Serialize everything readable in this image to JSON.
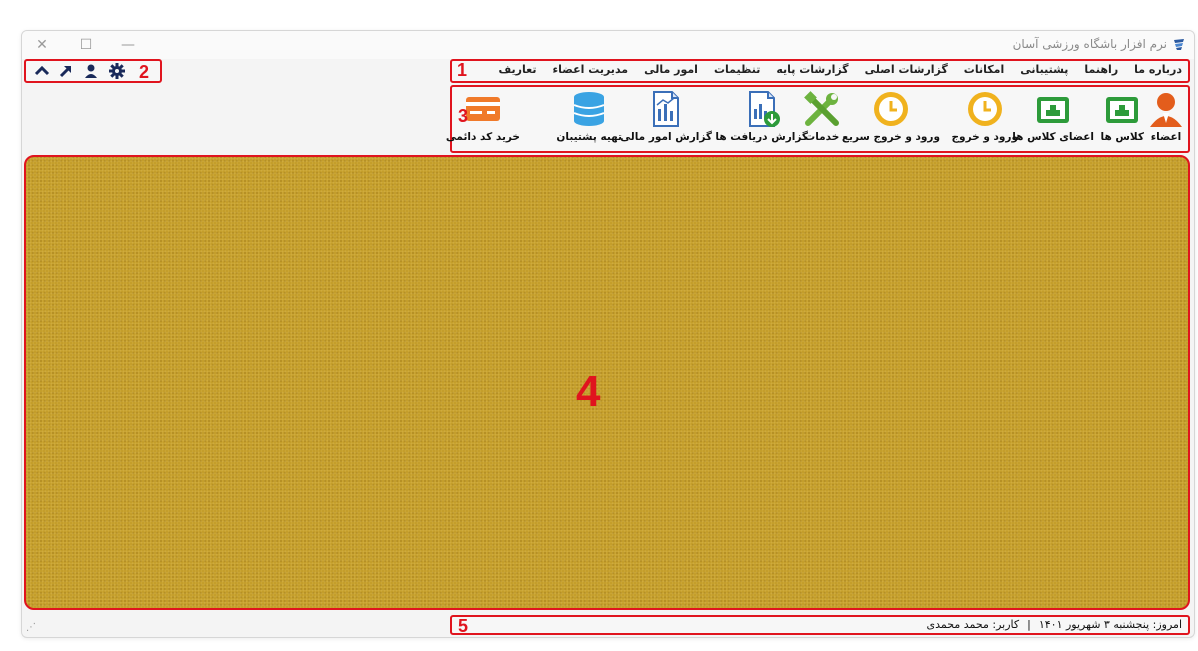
{
  "window": {
    "title": "نرم افزار باشگاه ورزشی آسان",
    "controls": {
      "close": "✕",
      "maximize": "☐",
      "minimize": "—"
    }
  },
  "menu": {
    "items": [
      "تعاریف",
      "مدیریت اعضاء",
      "امور مالی",
      "تنظیمات",
      "گزارشات پایه",
      "گزارشات اصلی",
      "امکانات",
      "پشتیبانی",
      "راهنما",
      "درباره ما"
    ]
  },
  "quickbar": {
    "icons": [
      "collapse-icon",
      "external-link-icon",
      "user-icon",
      "settings-icon"
    ]
  },
  "toolbar": {
    "items": [
      {
        "label": "اعضاء",
        "icon": "member-icon"
      },
      {
        "label": "کلاس ها",
        "icon": "class-icon"
      },
      {
        "label": "اعضای کلاس ها",
        "icon": "class-members-icon"
      },
      {
        "label": "ورود و خروج",
        "icon": "clock-icon"
      },
      {
        "label": "ورود و خروج سریع",
        "icon": "quick-clock-icon"
      },
      {
        "label": "خدمات",
        "icon": "tools-icon"
      },
      {
        "label": "گزارش دریافت ها",
        "icon": "receipts-report-icon"
      },
      {
        "label": "گزارش امور مالی",
        "icon": "finance-report-icon"
      },
      {
        "label": "تهیه پشتیبان",
        "icon": "database-icon"
      },
      {
        "label": "خرید کد دائمی",
        "icon": "credit-card-icon"
      }
    ]
  },
  "status": {
    "today": "امروز: پنجشنبه ۳ شهریور ۱۴۰۱",
    "separator": "|",
    "user": "کاربر: محمد محمدی"
  },
  "regions": {
    "menu": "1",
    "quickbar": "2",
    "toolbar": "3",
    "workspace": "4",
    "status": "5"
  },
  "colors": {
    "annotation": "#e0141e",
    "workspace_bg": "#c49e2b",
    "member_icon": "#e35d1c",
    "green_icon": "#2d9b3a",
    "clock_icon": "#f0b21e",
    "tools_icon": "#6db33f",
    "report_icon": "#3b6fb8",
    "database_icon": "#3aa3e3",
    "card_icon": "#f07a2a"
  }
}
